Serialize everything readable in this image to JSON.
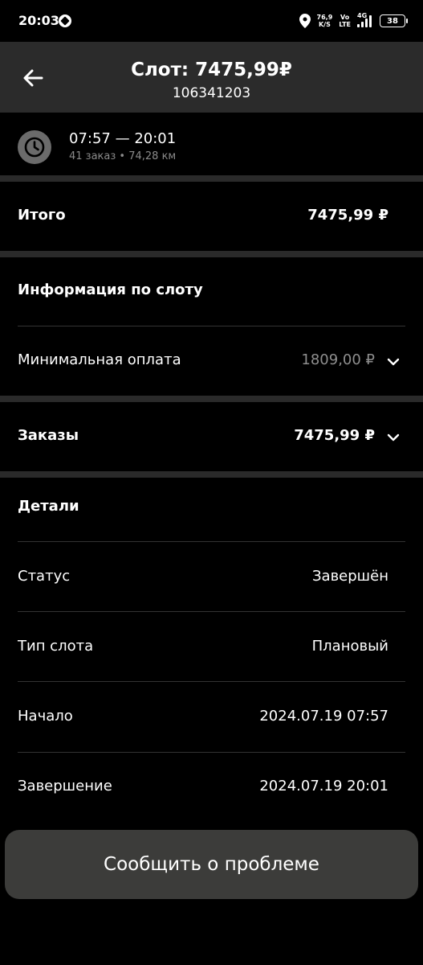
{
  "status_bar": {
    "time": "20:03",
    "net_speed_value": "76,9",
    "net_speed_unit": "K/S",
    "volte_top": "Vo",
    "volte_bottom": "LTE",
    "network_type": "4G",
    "battery": "38"
  },
  "header": {
    "title": "Слот: 7475,99₽",
    "subtitle": "106341203",
    "back_icon": "arrow-left-icon"
  },
  "slot_time": {
    "range": "07:57 — 20:01",
    "meta": "41 заказ • 74,28 км",
    "icon": "clock-icon"
  },
  "total": {
    "label": "Итого",
    "value": "7475,99 ₽"
  },
  "slot_info": {
    "heading": "Информация по слоту",
    "min_payment_label": "Минимальная оплата",
    "min_payment_value": "1809,00 ₽"
  },
  "orders": {
    "label": "Заказы",
    "value": "7475,99 ₽"
  },
  "details": {
    "heading": "Детали",
    "rows": [
      {
        "label": "Статус",
        "value": "Завершён"
      },
      {
        "label": "Тип слота",
        "value": "Плановый"
      },
      {
        "label": "Начало",
        "value": "2024.07.19 07:57"
      },
      {
        "label": "Завершение",
        "value": "2024.07.19 20:01"
      }
    ]
  },
  "report_button": {
    "label": "Сообщить о проблеме"
  },
  "colors": {
    "background": "#000000",
    "header_bg": "#2b2b2b",
    "divider": "#2a2a2a",
    "button_bg": "#3c3c3a",
    "muted_text": "#8e8e8e"
  }
}
